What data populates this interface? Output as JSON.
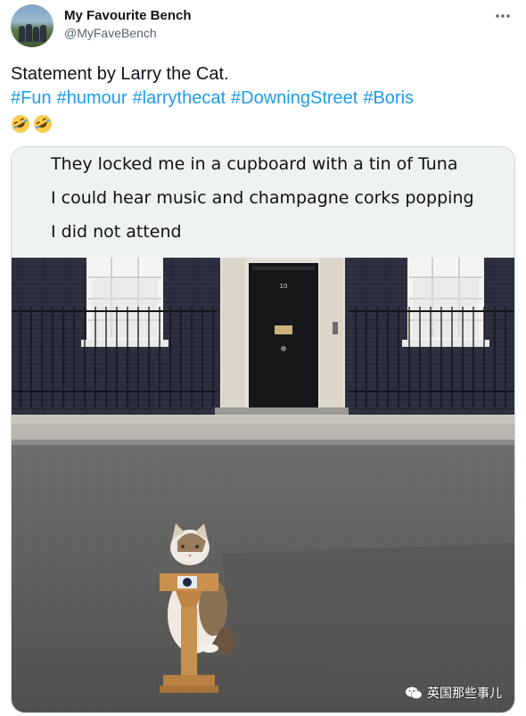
{
  "author": {
    "display_name": "My Favourite Bench",
    "handle": "@MyFaveBench"
  },
  "tweet": {
    "text": "Statement by Larry the Cat.",
    "hashtags": [
      "#Fun",
      "#humour",
      "#larrythecat",
      "#DowningStreet",
      "#Boris"
    ],
    "emojis": [
      "rolling-on-floor-laughing",
      "rolling-on-floor-laughing"
    ]
  },
  "media": {
    "caption_lines": [
      "They locked me in a cupboard with a tin of Tuna",
      "I could hear music and champagne corks popping",
      "I did not attend"
    ],
    "door_number": "10",
    "watermark": "英国那些事儿"
  },
  "colors": {
    "link": "#1d9bf0",
    "secondary_text": "#536471",
    "card_border": "#cfd9de",
    "caption_bg": "#eef2f2",
    "brick": "#2c3040"
  },
  "icons": {
    "more": "more-options-icon",
    "watermark": "wechat-icon"
  }
}
